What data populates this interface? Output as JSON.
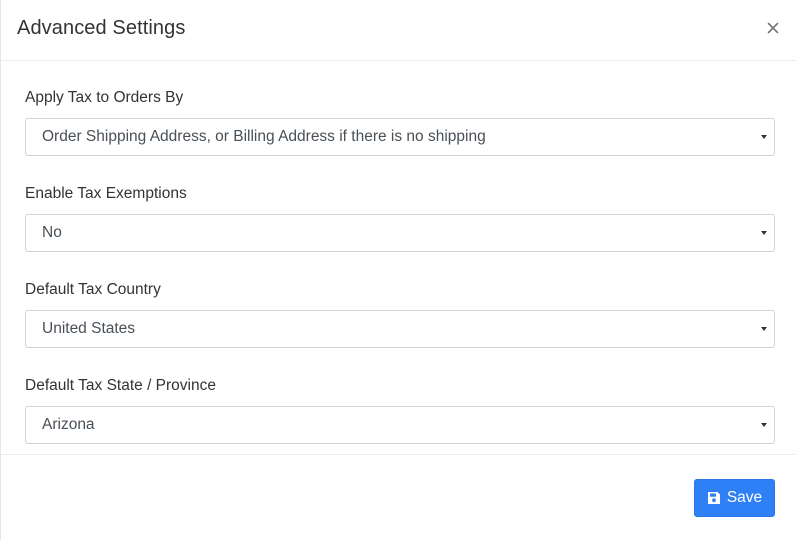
{
  "dialog": {
    "title": "Advanced Settings",
    "close_icon": "close-icon"
  },
  "fields": [
    {
      "label": "Apply Tax to Orders By",
      "value": "Order Shipping Address, or Billing Address if there is no shipping"
    },
    {
      "label": "Enable Tax Exemptions",
      "value": "No"
    },
    {
      "label": "Default Tax Country",
      "value": "United States"
    },
    {
      "label": "Default Tax State / Province",
      "value": "Arizona"
    }
  ],
  "footer": {
    "save_label": "Save",
    "save_icon": "floppy-disk-icon"
  },
  "colors": {
    "primary": "#2f80f6",
    "border": "#ced4da",
    "divider": "#e9ecef"
  }
}
